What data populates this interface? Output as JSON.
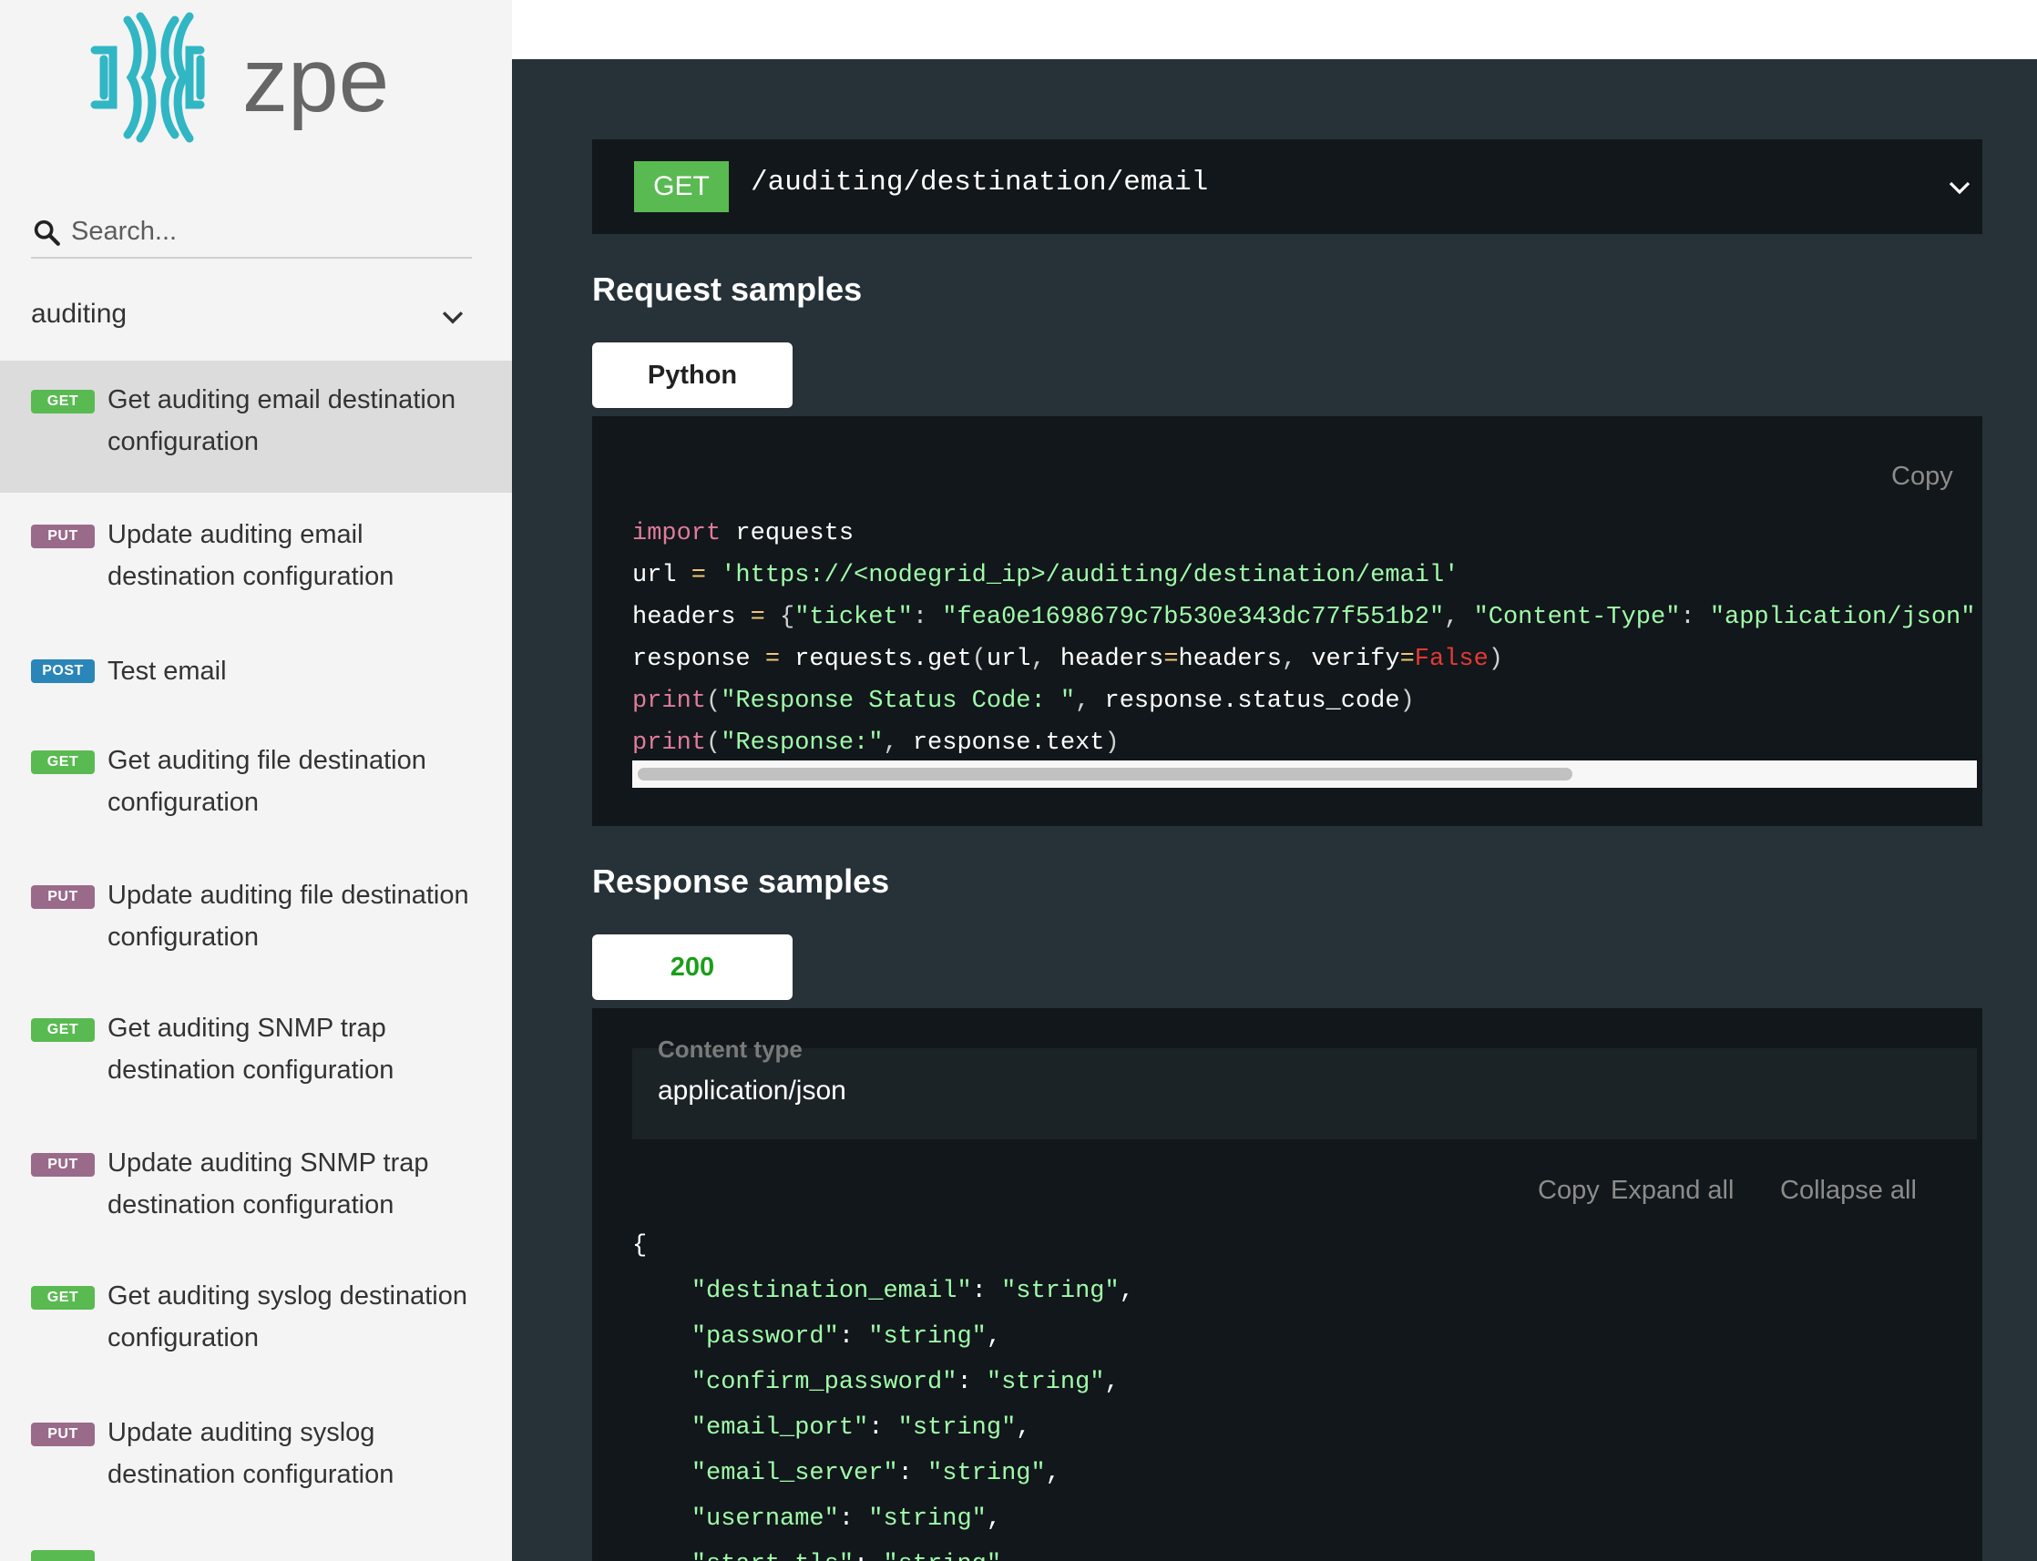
{
  "brand": {
    "name": "zpe",
    "accent": "#31b6c4",
    "text_color": "#666666"
  },
  "sidebar": {
    "search_placeholder": "Search...",
    "group": {
      "label": "auditing",
      "icon": "chevron-down-icon"
    },
    "items": [
      {
        "method": "GET",
        "label": "Get auditing email destination configuration",
        "active": true
      },
      {
        "method": "PUT",
        "label": "Update auditing email destination configuration"
      },
      {
        "method": "POST",
        "label": "Test email"
      },
      {
        "method": "GET",
        "label": "Get auditing file destination configuration"
      },
      {
        "method": "PUT",
        "label": "Update auditing file destination configuration"
      },
      {
        "method": "GET",
        "label": "Get auditing SNMP trap destination configuration"
      },
      {
        "method": "PUT",
        "label": "Update auditing SNMP trap destination configuration"
      },
      {
        "method": "GET",
        "label": "Get auditing syslog destination configuration"
      },
      {
        "method": "PUT",
        "label": "Update auditing syslog destination configuration"
      }
    ]
  },
  "endpoint": {
    "method": "GET",
    "path": "/auditing/destination/email"
  },
  "request": {
    "title": "Request samples",
    "tab": "Python",
    "copy_label": "Copy",
    "code": {
      "kw_import": "import",
      "mod_requests": " requests",
      "var_url": "url",
      "assign": " = ",
      "url_string": "'https://<nodegrid_ip>/auditing/destination/email'",
      "var_headers": "headers",
      "open_brace": "{",
      "key_ticket": "\"ticket\"",
      "colon_sp": ": ",
      "val_ticket": "\"fea0e1698679c7b530e343dc77f551b2\"",
      "comma_sp": ", ",
      "key_ctype": "\"Content-Type\"",
      "val_ctype": "\"application/json\"",
      "close_brace": "}",
      "var_response": "response",
      "call_get": "requests.get",
      "open_paren": "(",
      "arg_url": "url",
      "kw_headers": "headers",
      "eq": "=",
      "arg_headers": "headers",
      "kw_verify": "verify",
      "false_val": "False",
      "close_paren": ")",
      "fn_print": "print",
      "str_status": "\"Response Status Code: \"",
      "arg_status": "response.status_code",
      "str_response": "\"Response:\"",
      "arg_text": "response.text"
    }
  },
  "response": {
    "title": "Response samples",
    "tab": "200",
    "tab_color": "#1a9e1a",
    "content_type_label": "Content type",
    "content_type_value": "application/json",
    "actions": {
      "copy": "Copy",
      "expand": "Expand all",
      "collapse": "Collapse all"
    },
    "json_open": "{",
    "json_fields": [
      {
        "key": "\"destination_email\"",
        "value": "\"string\""
      },
      {
        "key": "\"password\"",
        "value": "\"string\""
      },
      {
        "key": "\"confirm_password\"",
        "value": "\"string\""
      },
      {
        "key": "\"email_port\"",
        "value": "\"string\""
      },
      {
        "key": "\"email_server\"",
        "value": "\"string\""
      },
      {
        "key": "\"username\"",
        "value": "\"string\""
      },
      {
        "key": "\"start_tls\"",
        "value": "\"string\""
      }
    ]
  },
  "colors": {
    "get": "#5aba52",
    "put": "#9a6a8a",
    "post": "#2a85b8",
    "panel_bg": "#263238",
    "code_bg": "#11171a"
  }
}
